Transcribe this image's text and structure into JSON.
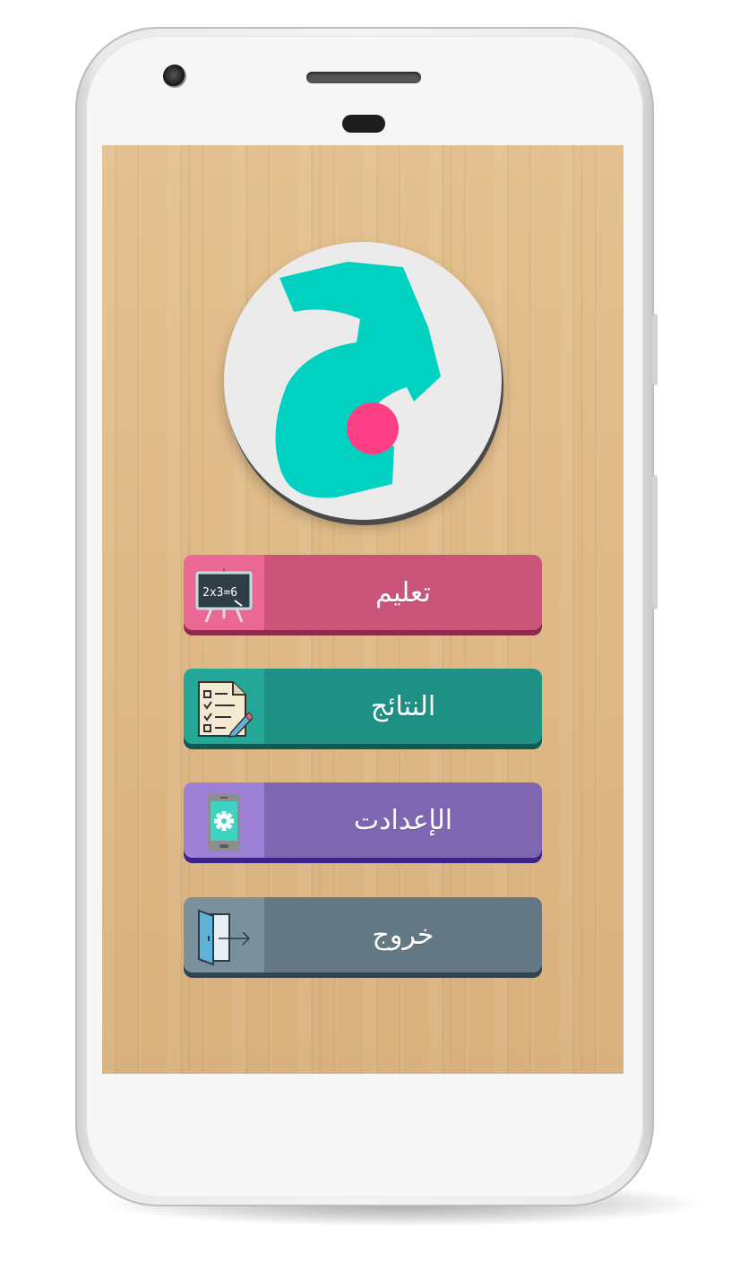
{
  "menu": {
    "items": [
      {
        "label": "تعليم",
        "icon": "blackboard-icon",
        "board_text": "2x3=6"
      },
      {
        "label": "النتائج",
        "icon": "checklist-icon"
      },
      {
        "label": "الإعدادت",
        "icon": "phone-gear-icon"
      },
      {
        "label": "خروج",
        "icon": "exit-door-icon"
      }
    ]
  },
  "logo": {
    "icon": "app-logo-icon"
  },
  "colors": {
    "learn": "#cb557a",
    "results": "#1f9184",
    "settings": "#7f66b0",
    "exit": "#637784",
    "logo_teal": "#00d1c1",
    "logo_pink": "#ff3f85"
  }
}
